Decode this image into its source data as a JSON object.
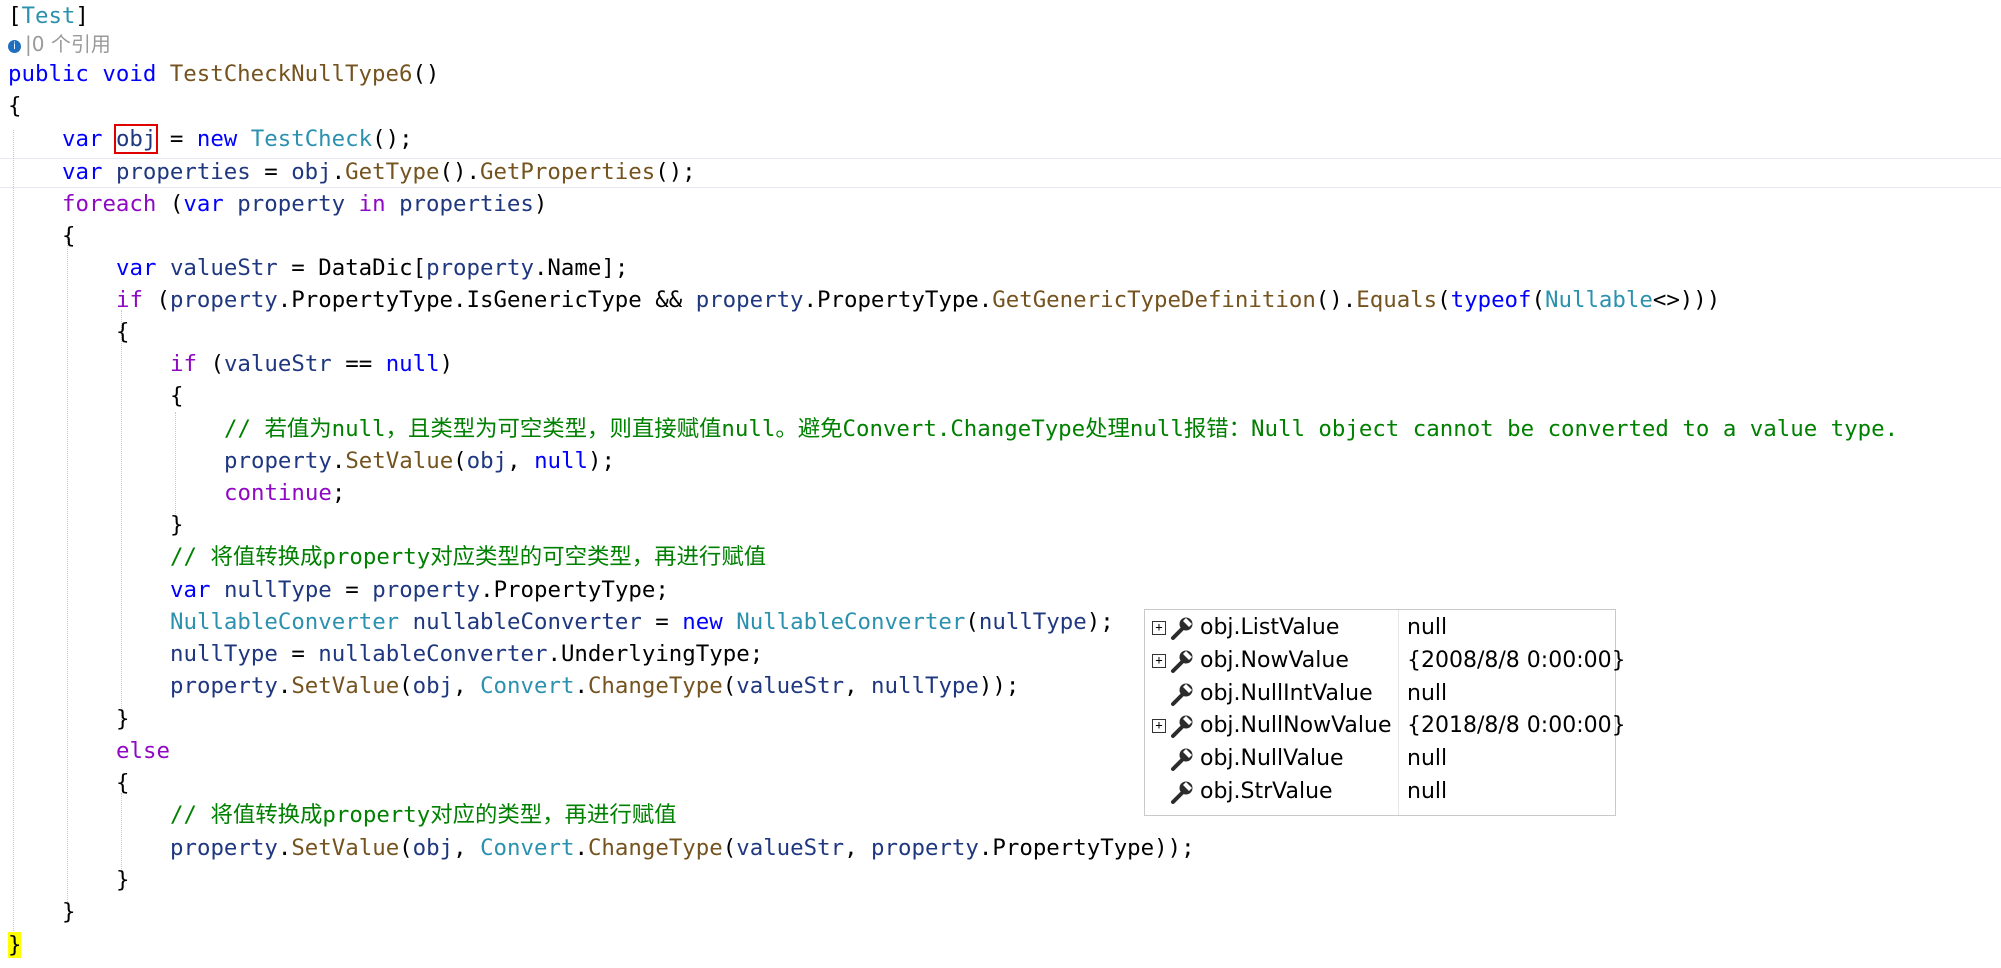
{
  "code": {
    "attr_open": "[",
    "attr_name": "Test",
    "attr_close": "]",
    "codelens": "|0 个引用",
    "sig_public": "public",
    "sig_void": "void",
    "sig_method": "TestCheckNullType6",
    "sig_parens": "()",
    "open_brace": "{",
    "close_brace": "}",
    "kw_var": "var",
    "kw_new": "new",
    "kw_foreach": "foreach",
    "kw_in": "in",
    "kw_if": "if",
    "kw_null": "null",
    "kw_continue": "continue",
    "kw_else": "else",
    "kw_typeof": "typeof",
    "obj": "obj",
    "properties": "properties",
    "property": "property",
    "valueStr": "valueStr",
    "nullType": "nullType",
    "nullableConverter": "nullableConverter",
    "TestCheck": "TestCheck",
    "GetType": "GetType",
    "GetProperties": "GetProperties",
    "DataDic": "DataDic",
    "Name": "Name",
    "PropertyType": "PropertyType",
    "IsGenericType": "IsGenericType",
    "GetGenericTypeDefinition": "GetGenericTypeDefinition",
    "Equals": "Equals",
    "Nullable": "Nullable",
    "SetValue": "SetValue",
    "Convert": "Convert",
    "ChangeType": "ChangeType",
    "NullableConverter": "NullableConverter",
    "UnderlyingType": "UnderlyingType",
    "comment1": "// 若值为null，且类型为可空类型，则直接赋值null。避免Convert.ChangeType处理null报错：Null object cannot be converted to a value type.",
    "comment2": "// 将值转换成property对应类型的可空类型，再进行赋值",
    "comment3": "// 将值转换成property对应的类型，再进行赋值"
  },
  "datatip": {
    "rows": [
      {
        "name": "obj.ListValue",
        "value": "null",
        "expandable": true
      },
      {
        "name": "obj.NowValue",
        "value": "{2008/8/8 0:00:00}",
        "expandable": true
      },
      {
        "name": "obj.NullIntValue",
        "value": "null",
        "expandable": false
      },
      {
        "name": "obj.NullNowValue",
        "value": "{2018/8/8 0:00:00}",
        "expandable": true
      },
      {
        "name": "obj.NullValue",
        "value": "null",
        "expandable": false
      },
      {
        "name": "obj.StrValue",
        "value": "null",
        "expandable": false
      }
    ],
    "expander_glyph": "+",
    "icon": "wrench-icon"
  },
  "colors": {
    "keyword": "#0000ff",
    "control_keyword": "#8f08c4",
    "type": "#2b91af",
    "method": "#74531f",
    "variable": "#1f377f",
    "comment": "#008000",
    "highlight_box": "#e00000",
    "brace_highlight": "#ffff00"
  }
}
